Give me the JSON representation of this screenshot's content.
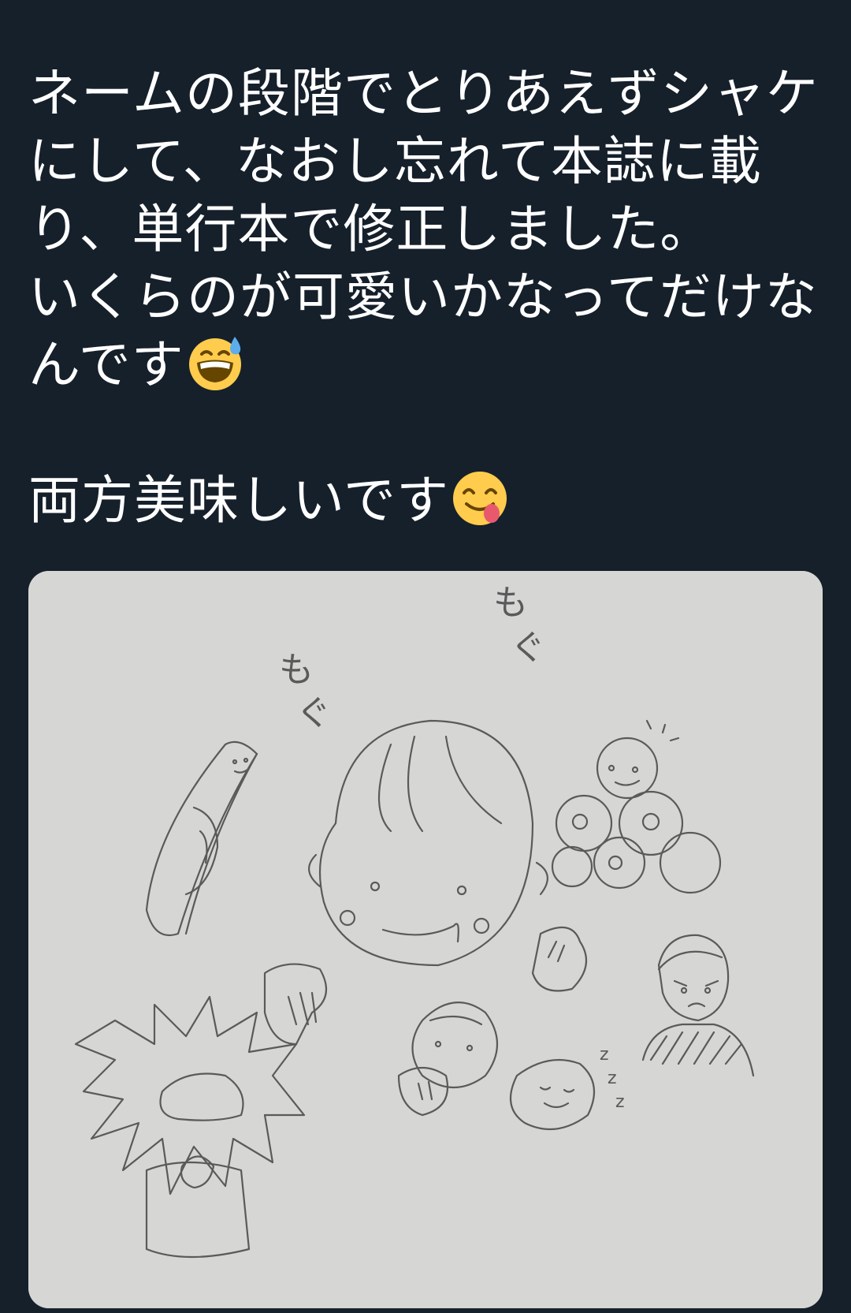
{
  "tweet": {
    "lines": [
      "ネームの段階でとりあえずシャケ",
      "にして、なおし忘れて本誌に載",
      "り、単行本で修正しました。",
      "いくらのが可愛いかなってだけな",
      "んです",
      "両方美味しいです"
    ],
    "emoji": {
      "sweat_smile": "grinning-face-with-sweat",
      "yum": "face-savoring-food"
    },
    "colors": {
      "background": "#15202b",
      "text": "#ffffff"
    }
  },
  "media": {
    "drawing_text": {
      "mogu_left_1": "も",
      "mogu_left_2": "ぐ",
      "mogu_top_1": "も",
      "mogu_top_2": "ぐ",
      "zzz_1": "z",
      "zzz_2": "z",
      "zzz_3": "z"
    }
  }
}
